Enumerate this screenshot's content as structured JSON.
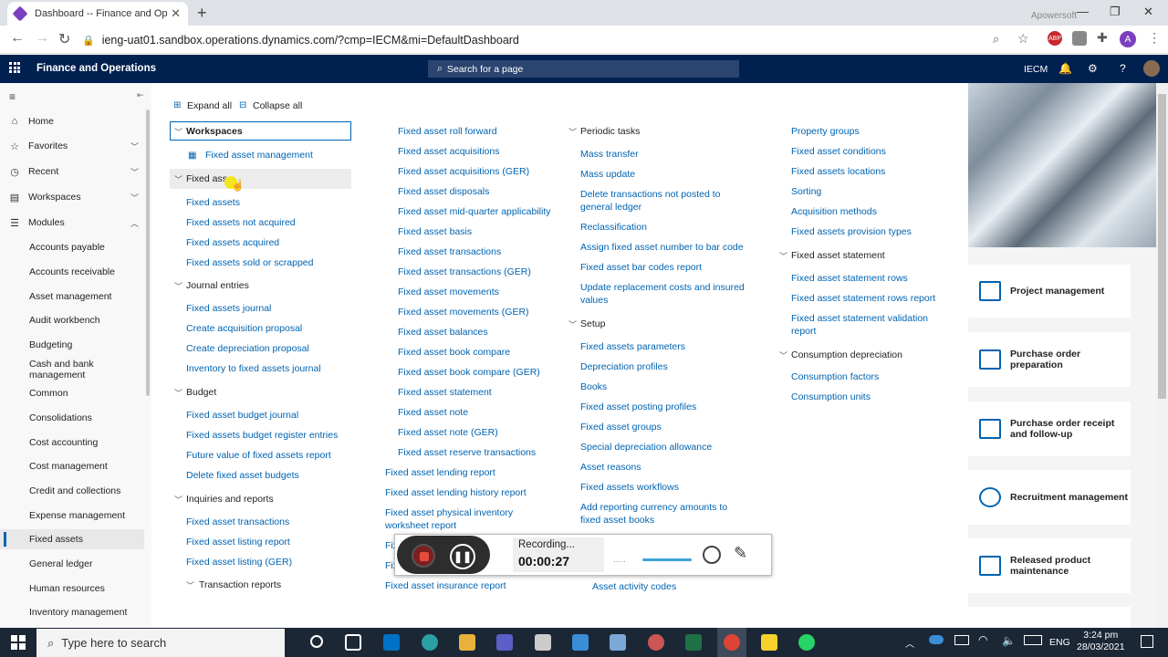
{
  "browser": {
    "tab_title": "Dashboard -- Finance and Operat",
    "url": "ieng-uat01.sandbox.operations.dynamics.com/?cmp=IECM&mi=DefaultDashboard",
    "watermark": "Apowersoft",
    "profile_initial": "A",
    "abp": "ABP"
  },
  "app": {
    "title": "Finance and Operations",
    "search_placeholder": "Search for a page",
    "company": "IECM"
  },
  "nav": {
    "home": "Home",
    "favorites": "Favorites",
    "recent": "Recent",
    "workspaces": "Workspaces",
    "modules": "Modules",
    "module_items": [
      "Accounts payable",
      "Accounts receivable",
      "Asset management",
      "Audit workbench",
      "Budgeting",
      "Cash and bank management",
      "Common",
      "Consolidations",
      "Cost accounting",
      "Cost management",
      "Credit and collections",
      "Expense management",
      "Fixed assets",
      "General ledger",
      "Human resources",
      "Inventory management"
    ]
  },
  "toolbar": {
    "expand_all": "Expand all",
    "collapse_all": "Collapse all"
  },
  "col1": {
    "workspaces": "Workspaces",
    "fam": "Fixed asset management",
    "fixed_assets": "Fixed asse",
    "fa_links": [
      "Fixed assets",
      "Fixed assets not acquired",
      "Fixed assets acquired",
      "Fixed assets sold or scrapped"
    ],
    "journal_entries": "Journal entries",
    "je_links": [
      "Fixed assets journal",
      "Create acquisition proposal",
      "Create depreciation proposal",
      "Inventory to fixed assets journal"
    ],
    "budget": "Budget",
    "budget_links": [
      "Fixed asset budget journal",
      "Fixed assets budget register entries",
      "Future value of fixed assets report",
      "Delete fixed asset budgets"
    ],
    "inquiries": "Inquiries and reports",
    "inq_links": [
      "Fixed asset transactions",
      "Fixed asset listing report",
      "Fixed asset listing (GER)"
    ],
    "transaction_reports": "Transaction reports"
  },
  "col2": {
    "links": [
      "Fixed asset roll forward",
      "Fixed asset acquisitions",
      "Fixed asset acquisitions (GER)",
      "Fixed asset disposals",
      "Fixed asset mid-quarter applicability",
      "Fixed asset basis",
      "Fixed asset transactions",
      "Fixed asset transactions (GER)",
      "Fixed asset movements",
      "Fixed asset movements (GER)",
      "Fixed asset balances",
      "Fixed asset book compare",
      "Fixed asset book compare (GER)",
      "Fixed asset statement",
      "Fixed asset note",
      "Fixed asset note (GER)",
      "Fixed asset reserve transactions"
    ],
    "links2": [
      "Fixed asset lending report",
      "Fixed asset lending history report"
    ],
    "physical_inventory": [
      "Fixed asset physical inventory",
      "worksheet report"
    ],
    "partial1": "Fix",
    "partial2": "Fix",
    "insurance": "Fixed asset insurance report"
  },
  "col3": {
    "periodic": "Periodic tasks",
    "periodic_links": [
      "Mass transfer",
      "Mass update"
    ],
    "delete_tx": [
      "Delete transactions not posted to",
      "general ledger"
    ],
    "periodic_links2": [
      "Reclassification",
      "Assign fixed asset number to bar code",
      "Fixed asset bar codes report"
    ],
    "update_repl": [
      "Update replacement costs and insured",
      "values"
    ],
    "setup": "Setup",
    "setup_links": [
      "Fixed assets parameters",
      "Depreciation profiles",
      "Books",
      "Fixed asset posting profiles",
      "Fixed asset groups",
      "Special depreciation allowance",
      "Asset reasons",
      "Fixed assets workflows"
    ],
    "add_reporting": [
      "Add reporting currency amounts to",
      "fixed asset books"
    ],
    "activity_codes": "Asset activity codes"
  },
  "col4": {
    "links": [
      "Property groups",
      "Fixed asset conditions",
      "Fixed assets locations",
      "Sorting",
      "Acquisition methods",
      "Fixed assets provision types"
    ],
    "statement": "Fixed asset statement",
    "statement_links": [
      "Fixed asset statement rows",
      "Fixed asset statement rows report"
    ],
    "validation": [
      "Fixed asset statement validation",
      "report"
    ],
    "consumption": "Consumption depreciation",
    "consumption_links": [
      "Consumption factors",
      "Consumption units"
    ]
  },
  "tiles": [
    {
      "label": "Project management"
    },
    {
      "label": "Purchase order preparation"
    },
    {
      "label": "Purchase order receipt and follow-up"
    },
    {
      "label": "Recruitment management"
    },
    {
      "label": "Released product maintenance"
    }
  ],
  "recording": {
    "label": "Recording...",
    "time": "00:00:27"
  },
  "taskbar": {
    "search": "Type here to search",
    "lang": "ENG",
    "time": "3:24 pm",
    "date": "28/03/2021"
  }
}
